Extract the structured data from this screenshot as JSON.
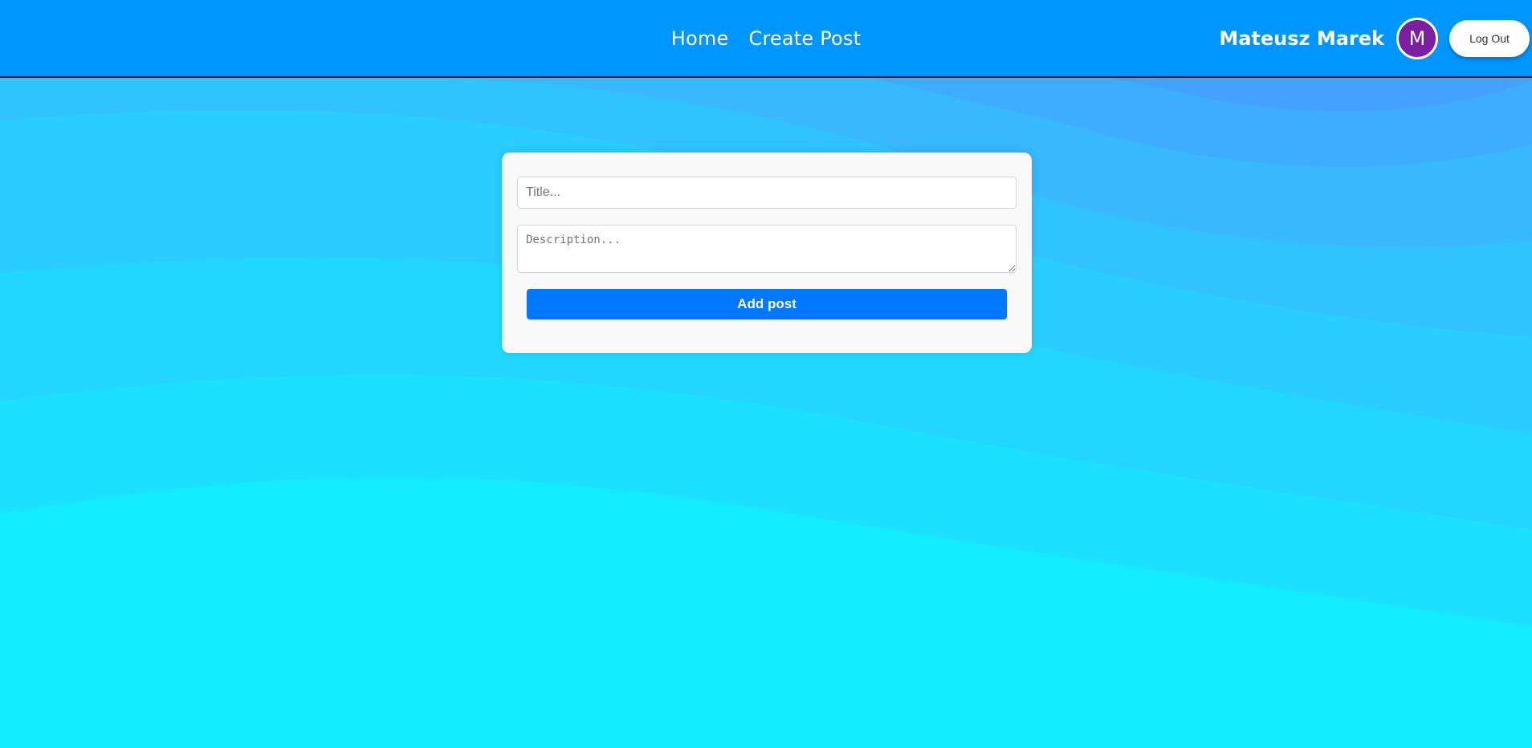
{
  "navbar": {
    "links": [
      {
        "label": "Home"
      },
      {
        "label": "Create Post"
      }
    ],
    "user": {
      "name": "Mateusz Marek",
      "avatar_initial": "M",
      "avatar_color": "#7b1fa2"
    },
    "logout_label": "Log Out",
    "background_color": "#0096ff"
  },
  "form": {
    "title_placeholder": "Title...",
    "title_value": "",
    "description_placeholder": "Description...",
    "description_value": "",
    "submit_label": "Add post",
    "submit_color": "#0078ff"
  },
  "background": {
    "top_color": "#43a2ff",
    "bottom_color": "#12ecff"
  }
}
